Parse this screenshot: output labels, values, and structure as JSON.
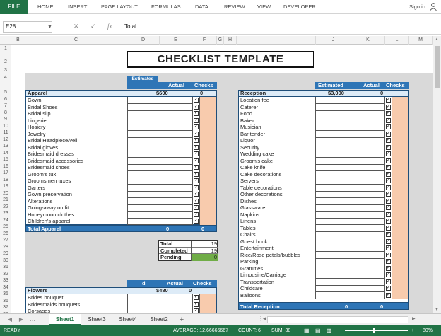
{
  "ribbon": {
    "file": "FILE",
    "tabs": [
      "HOME",
      "INSERT",
      "PAGE LAYOUT",
      "FORMULAS",
      "DATA",
      "REVIEW",
      "VIEW",
      "DEVELOPER"
    ],
    "signin": "Sign in"
  },
  "formula_bar": {
    "name_box": "E28",
    "cancel": "✕",
    "enter": "✓",
    "fx": "fx",
    "content": "Total"
  },
  "columns": [
    "B",
    "C",
    "D",
    "E",
    "F",
    "G",
    "H",
    "I",
    "J",
    "K",
    "L",
    "M"
  ],
  "rows": [
    "1",
    "2",
    "3",
    "4",
    "5",
    "6",
    "7",
    "8",
    "9",
    "10",
    "11",
    "12",
    "13",
    "14",
    "15",
    "16",
    "17",
    "18",
    "19",
    "20",
    "21",
    "22",
    "23",
    "24",
    "25",
    "26",
    "27",
    "28",
    "29",
    "30",
    "31",
    "32",
    "33",
    "34",
    "35",
    "36",
    "37",
    "38"
  ],
  "sheet": {
    "title": "CHECKLIST TEMPLATE",
    "apparel": {
      "col_estimated": "Estimated",
      "col_actual": "Actual",
      "col_checks": "Checks",
      "label": "Apparel",
      "estimated": "$600",
      "actual": "0",
      "items": [
        "Gown",
        "Bridal Shoes",
        "Bridal slip",
        "Lingerie",
        "Hosiery",
        "Jewelry",
        "Bridal Headpiece/veil",
        "Bridal gloves",
        "Bridesmaid dresses",
        "Bridesmaid accessories",
        "Bridesmaid shoes",
        "Groom's tux",
        "Groomsmen tuxes",
        "Garters",
        "Gown preservation",
        "Alterations",
        "Going-away outfit",
        "Honeymoon clothes",
        "Children's apparel"
      ],
      "total_label": "Total Apparel",
      "total_estimated": "0",
      "total_actual": "0"
    },
    "status": {
      "total_label": "Total",
      "total_value": "19",
      "completed_label": "Completed",
      "completed_value": "19",
      "pending_label": "Pending",
      "pending_value": "0"
    },
    "flowers": {
      "col_estimated": "d",
      "col_actual": "Actual",
      "col_checks": "Checks",
      "label": "Flowers",
      "estimated": "$480",
      "actual": "0",
      "items": [
        "Brides bouquet",
        "Bridesmaids bouquets",
        "Corsages"
      ]
    },
    "reception": {
      "col_estimated": "Estimated",
      "col_actual": "Actual",
      "col_checks": "Checks",
      "label": "Reception",
      "estimated": "$3,000",
      "actual": "0",
      "items": [
        "Location fee",
        "Caterer",
        "Food",
        "Baker",
        "Musician",
        "Bar tender",
        "Liquor",
        "Security",
        "Wedding cake",
        "Groom's cake",
        "Cake knife",
        "Cake decorations",
        "Servers",
        "Table decorations",
        "Other decorations",
        "Dishes",
        "Glassware",
        "Napkins",
        "Linens",
        "Tables",
        "Chairs",
        "Guest book",
        "Entertainment",
        "Rice/Rose petals/bubbles",
        "Parking",
        "Gratuities",
        "Limousine/Carriage",
        "Transportation",
        "Childcare",
        "Balloons"
      ],
      "total_label": "Total Reception",
      "total_estimated": "0",
      "total_actual": "0"
    }
  },
  "sheet_tabs": [
    "Sheet1",
    "Sheet3",
    "Sheet4",
    "Sheet2"
  ],
  "add_sheet": "+",
  "status_bar": {
    "ready": "READY",
    "average": "AVERAGE: 12.66666667",
    "count": "COUNT: 6",
    "sum": "SUM: 38",
    "zoom": "80%"
  },
  "colors": {
    "excel_green": "#217346",
    "header_blue": "#2e75b6",
    "peach": "#f8cbad",
    "pending_green": "#70ad47"
  }
}
